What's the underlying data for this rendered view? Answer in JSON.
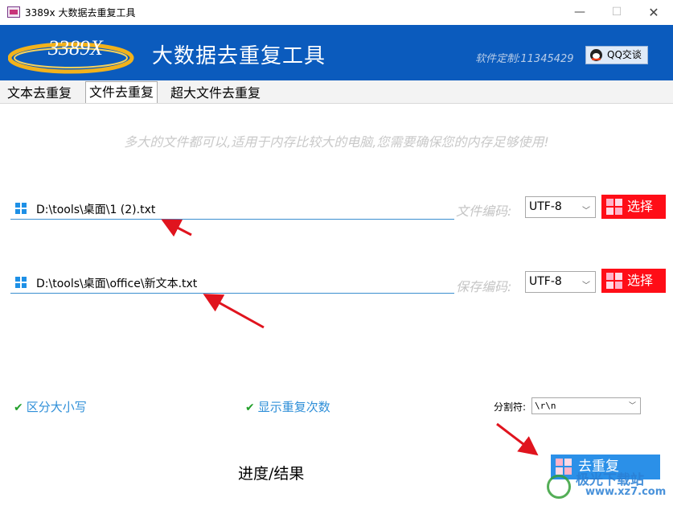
{
  "window": {
    "title": "3389x 大数据去重复工具",
    "minimize": "—",
    "maximize": "☐",
    "close": "✕"
  },
  "banner": {
    "logo_text": "3389X",
    "heading": "大数据去重复工具",
    "custom_note": "软件定制:11345429",
    "qq_button": "QQ交谈"
  },
  "tabs": [
    {
      "label": "文本去重复",
      "active": false
    },
    {
      "label": "文件去重复",
      "active": true
    },
    {
      "label": "超大文件去重复",
      "active": false
    }
  ],
  "hint": "多大的文件都可以,适用于内存比较大的电脑,您需要确保您的内存足够使用!",
  "input_file": {
    "path": "D:\\tools\\桌面\\1 (2).txt",
    "encoding_label": "文件编码:",
    "encoding": "UTF-8",
    "pick_label": "选择"
  },
  "output_file": {
    "path": "D:\\tools\\桌面\\office\\新文本.txt",
    "encoding_label": "保存编码:",
    "encoding": "UTF-8",
    "pick_label": "选择"
  },
  "options": {
    "case_sensitive": {
      "label": "区分大小写",
      "checked": true
    },
    "show_count": {
      "label": "显示重复次数",
      "checked": true
    },
    "separator_label": "分割符:",
    "separator_value": "\\r\\n"
  },
  "progress_text": "进度/结果",
  "run_button": "去重复",
  "watermark": {
    "name": "极光下载站",
    "url": "www.xz7.com"
  },
  "colors": {
    "banner": "#0b5bbd",
    "pick_button": "#ff0d17",
    "run_button": "#2b90e8",
    "annotation_arrow": "#e0141e"
  }
}
